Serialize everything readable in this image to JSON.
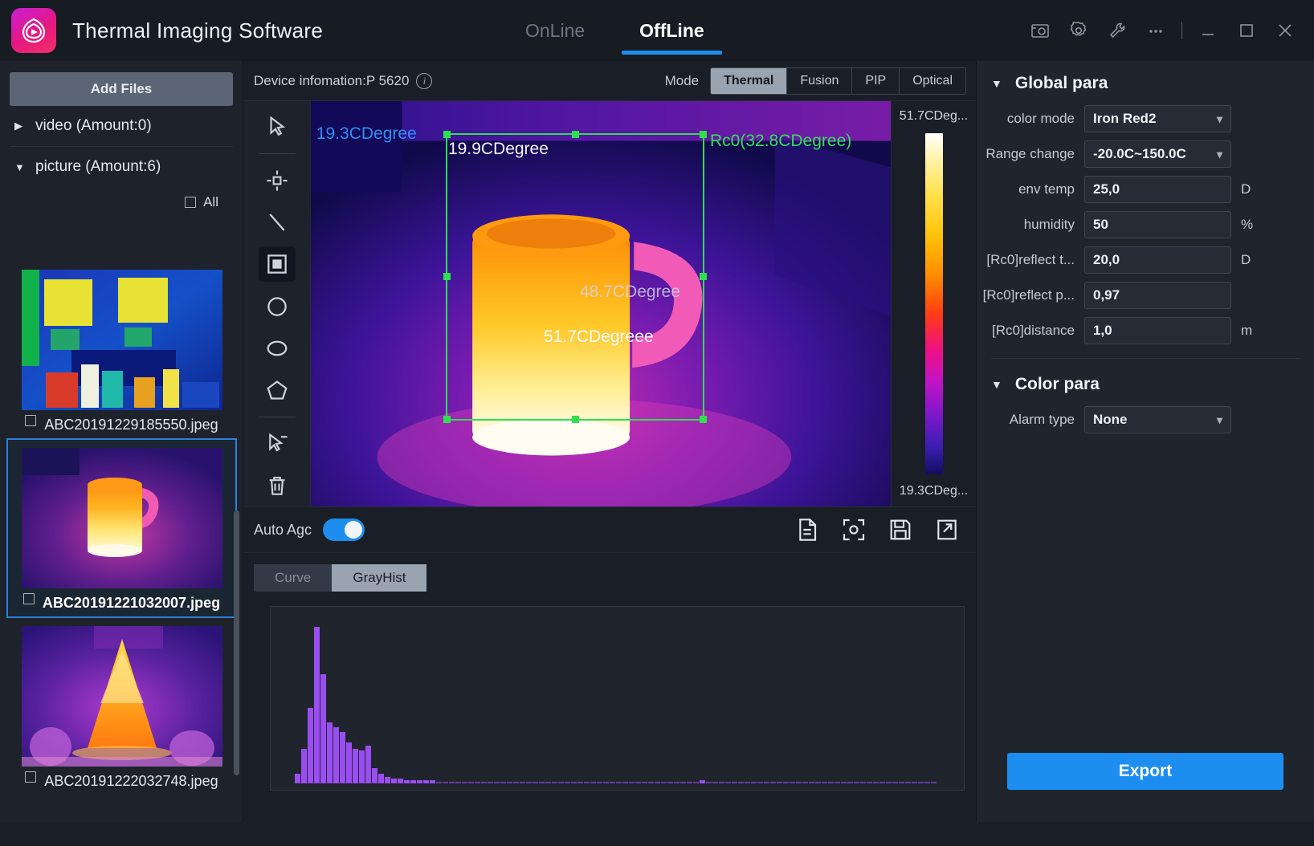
{
  "app": {
    "title": "Thermal Imaging Software",
    "logo_icon": "swirl-logo-icon"
  },
  "tabs": [
    {
      "label": "OnLine",
      "active": false
    },
    {
      "label": "OffLine",
      "active": true
    }
  ],
  "window_controls": [
    {
      "name": "screenshot-icon",
      "glyph": "camera"
    },
    {
      "name": "settings-gear-icon",
      "glyph": "gear"
    },
    {
      "name": "tools-wrench-icon",
      "glyph": "wrench"
    },
    {
      "name": "more-options-icon",
      "glyph": "ellipsis"
    },
    {
      "name": "minimize-button",
      "glyph": "minimize"
    },
    {
      "name": "maximize-button",
      "glyph": "maximize"
    },
    {
      "name": "close-button",
      "glyph": "close"
    }
  ],
  "sidebar": {
    "add_files_label": "Add Files",
    "tree": [
      {
        "label": "video (Amount:0)",
        "expanded": false
      },
      {
        "label": "picture (Amount:6)",
        "expanded": true
      }
    ],
    "select_all_label": "All",
    "files": [
      {
        "name": "ABC20191229185550.jpeg",
        "selected": false,
        "thumb": "room-thermal"
      },
      {
        "name": "ABC20191221032007.jpeg",
        "selected": true,
        "thumb": "mug-thermal"
      },
      {
        "name": "ABC20191222032748.jpeg",
        "selected": false,
        "thumb": "tree-thermal"
      }
    ]
  },
  "viewer": {
    "device_info": "Device infomation:P 5620",
    "info_icon": "info-icon",
    "mode_label": "Mode",
    "modes": [
      {
        "label": "Thermal",
        "active": true
      },
      {
        "label": "Fusion",
        "active": false
      },
      {
        "label": "PIP",
        "active": false
      },
      {
        "label": "Optical",
        "active": false
      }
    ],
    "tools": [
      {
        "name": "select-cursor-tool",
        "active": false
      },
      {
        "name": "spot-point-tool",
        "active": false
      },
      {
        "name": "line-tool",
        "active": false
      },
      {
        "name": "rectangle-tool",
        "active": true
      },
      {
        "name": "circle-tool",
        "active": false
      },
      {
        "name": "ellipse-tool",
        "active": false
      },
      {
        "name": "polygon-tool",
        "active": false
      },
      {
        "name": "deselect-tool",
        "active": false
      },
      {
        "name": "delete-tool",
        "active": false
      }
    ],
    "overlays": {
      "left_temp": "- 19.3CDegree",
      "min_temp": "19.9CDegree",
      "region_label": "Rc0(32.8CDegree)",
      "mid_temp": "48.7CDegree",
      "max_temp": "51.7CDegreee"
    },
    "colorbar": {
      "top_label": "51.7CDeg...",
      "bottom_label": "19.3CDeg..."
    },
    "agc": {
      "label": "Auto Agc",
      "enabled": true
    },
    "agc_icons": [
      {
        "name": "report-document-icon"
      },
      {
        "name": "focus-frame-icon"
      },
      {
        "name": "save-disk-icon"
      },
      {
        "name": "export-share-icon"
      }
    ]
  },
  "histogram": {
    "tabs": [
      {
        "label": "Curve",
        "active": false
      },
      {
        "label": "GrayHist",
        "active": true
      }
    ]
  },
  "chart_data": {
    "type": "bar",
    "title": "GrayHist",
    "xlabel": "",
    "ylabel": "",
    "grid": false,
    "legend": "none",
    "xlim": [
      0,
      256
    ],
    "ylim": [
      0,
      100
    ],
    "categories": [
      0,
      1,
      2,
      3,
      4,
      5,
      6,
      7,
      8,
      9,
      10,
      11,
      12,
      13,
      14,
      15,
      16,
      17,
      18,
      19,
      20,
      21,
      22,
      23,
      24,
      25,
      26,
      27,
      28,
      29,
      30,
      31,
      32,
      33,
      34,
      35,
      36,
      37,
      38,
      39,
      40,
      41,
      42,
      43,
      44,
      45,
      46,
      47,
      48,
      49,
      50,
      51,
      52,
      53,
      54,
      55,
      56,
      57,
      58,
      59,
      60,
      61,
      62,
      63,
      64,
      65,
      66,
      67,
      68,
      69,
      70,
      71,
      72,
      73,
      74,
      75,
      76,
      77,
      78,
      79,
      80,
      81,
      82,
      83,
      84,
      85,
      86,
      87,
      88,
      89,
      90,
      91,
      92,
      93,
      94,
      95,
      96,
      97,
      98,
      99
    ],
    "values": [
      6,
      22,
      48,
      100,
      70,
      39,
      36,
      33,
      26,
      22,
      21,
      24,
      10,
      6,
      4,
      3,
      3,
      2,
      2,
      2,
      2,
      2,
      1,
      1,
      1,
      1,
      1,
      1,
      1,
      1,
      1,
      1,
      1,
      1,
      1,
      1,
      1,
      1,
      1,
      1,
      0,
      0,
      0,
      0,
      0,
      0,
      0,
      0,
      0,
      0,
      0,
      0,
      0,
      0,
      1,
      1,
      1,
      1,
      1,
      1,
      1,
      1,
      1,
      2,
      1,
      1,
      1,
      1,
      1,
      1,
      1,
      1,
      1,
      1,
      1,
      1,
      1,
      1,
      1,
      1,
      1,
      1,
      1,
      1,
      1,
      1,
      1,
      1,
      1,
      1,
      1,
      1,
      1,
      1,
      1,
      1,
      1,
      1,
      1,
      1
    ],
    "bar_color": "#9a4ef0"
  },
  "params": {
    "global": {
      "title": "Global para",
      "rows": [
        {
          "label": "color mode",
          "value": "Iron Red2",
          "unit": "",
          "type": "select"
        },
        {
          "label": "Range change",
          "value": "-20.0C~150.0C",
          "unit": "",
          "type": "select"
        },
        {
          "label": "env temp",
          "value": "25,0",
          "unit": "D",
          "type": "input"
        },
        {
          "label": "humidity",
          "value": "50",
          "unit": "%",
          "type": "input"
        },
        {
          "label": "[Rc0]reflect t...",
          "value": "20,0",
          "unit": "D",
          "type": "input"
        },
        {
          "label": "[Rc0]reflect p...",
          "value": "0,97",
          "unit": "",
          "type": "input"
        },
        {
          "label": "[Rc0]distance",
          "value": "1,0",
          "unit": "m",
          "type": "input"
        }
      ]
    },
    "color": {
      "title": "Color para",
      "rows": [
        {
          "label": "Alarm type",
          "value": "None",
          "unit": "",
          "type": "select"
        }
      ]
    },
    "export_label": "Export"
  },
  "colors": {
    "accent": "#1d8ef0",
    "roi_green": "#2ee04f",
    "hist_purple": "#9a4ef0"
  }
}
